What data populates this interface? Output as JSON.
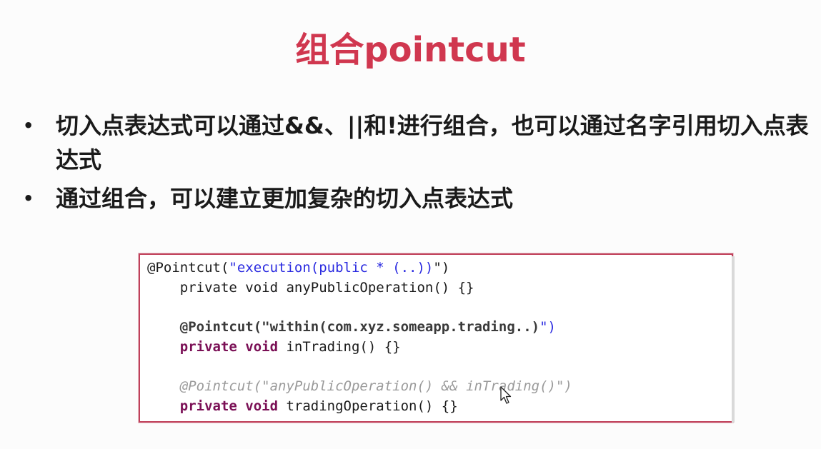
{
  "slide": {
    "title": "组合pointcut",
    "bullets": [
      "切入点表达式可以通过&&、||和!进行组合，也可以通过名字引用切入点表达式",
      "通过组合，可以建立更加复杂的切入点表达式"
    ],
    "bullet_marker": "•"
  },
  "code": {
    "line1": {
      "part1": "@Pointcut(",
      "part2": "\"execution(public * (..))",
      "part3": "\")"
    },
    "line2": "    private void anyPublicOperation() {}",
    "line3": {
      "part1": "    @Pointcut(\"within(com.xyz.someapp.trading..)",
      "part2": "\")"
    },
    "line4": {
      "part1": "    private void ",
      "part2": "inTrading() {}"
    },
    "line5": "    @Pointcut(\"anyPublicOperation() && inTrading()\")",
    "line6": {
      "part1": "    private void ",
      "part2": "tradingOperation() {}"
    }
  },
  "colors": {
    "title": "#d0374f",
    "code_border": "#c0405a",
    "code_string": "#2a2ae0",
    "code_keyword": "#7a0f55"
  },
  "icons": {
    "cursor": "mouse-pointer-icon"
  }
}
